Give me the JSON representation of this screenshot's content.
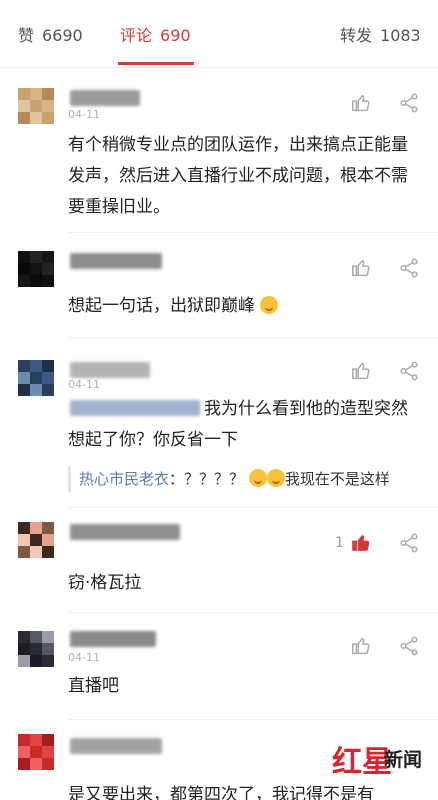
{
  "tabs": {
    "like_label": "赞",
    "like_count": "6690",
    "comments_label": "评论",
    "comments_count": "690",
    "forward_label": "转发",
    "forward_count": "1083"
  },
  "comments": [
    {
      "date": "04-11",
      "text": "有个稍微专业点的团队运作，出来搞点正能量发声，然后进入直播行业不成问题，根本不需要重操旧业。",
      "colors": [
        "#c9a26b",
        "#d7b486",
        "#b58a54",
        "#e0c69e"
      ]
    },
    {
      "date": "",
      "text": "想起一句话，出狱即巅峰",
      "colors": [
        "#111111",
        "#222222",
        "#161616",
        "#0a0a0a"
      ]
    },
    {
      "date": "04-11",
      "text": "我为什么看到他的造型突然想起了你？你反省一下",
      "reply_name": "热心市民老衣",
      "reply_text": "：？？？？",
      "reply_tail": "我现在不是这样",
      "colors": [
        "#2a3d5c",
        "#3b5a86",
        "#1f2f49",
        "#6d8bb3"
      ]
    },
    {
      "date": "",
      "text": "窃·格瓦拉",
      "like_count": "1",
      "colors": [
        "#3b2a1f",
        "#e7a38a",
        "#7a5a44",
        "#f2c6b3"
      ]
    },
    {
      "date": "04-11",
      "text": "直播吧",
      "colors": [
        "#2b2b35",
        "#565865",
        "#9a9cab",
        "#1c1c22"
      ]
    },
    {
      "date": "",
      "text": "是又要出来，都第四次了，我记得不是有",
      "colors": [
        "#c82a2a",
        "#e14444",
        "#a51d1d",
        "#f06060"
      ]
    }
  ],
  "watermark": {
    "red": "红星",
    "black": "新闻"
  },
  "icons": {
    "like": "thumbs-up-icon",
    "share": "share-icon",
    "liked_color": "#d33b3b"
  }
}
